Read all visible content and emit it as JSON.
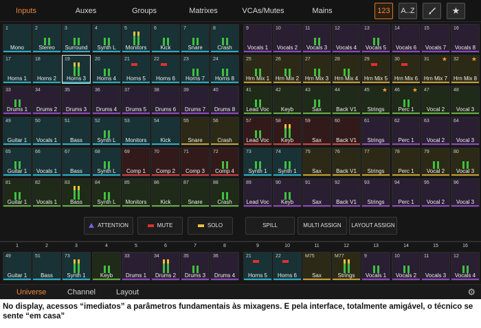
{
  "top_tabs": [
    "Inputs",
    "Auxes",
    "Groups",
    "Matrixes",
    "VCAs/Mutes",
    "Mains"
  ],
  "top_buttons": {
    "numeric": "123",
    "alpha": "A..Z"
  },
  "colors": {
    "accent": "#f0883a",
    "mute": "#e03030",
    "attention": "#7060e0",
    "solo": "#f0c040"
  },
  "grid_rows": [
    [
      {
        "n": "1",
        "name": "Mono",
        "c": "teal"
      },
      {
        "n": "2",
        "name": "Stereo",
        "c": "teal",
        "m": 1
      },
      {
        "n": "3",
        "name": "Surround",
        "c": "teal",
        "m": 1
      },
      {
        "n": "4",
        "name": "Synth L",
        "c": "teal",
        "m": 1
      },
      {
        "n": "5",
        "name": "Monitors",
        "c": "teal",
        "m": 2
      },
      {
        "n": "6",
        "name": "Kick",
        "c": "teal",
        "m": 1
      },
      {
        "n": "7",
        "name": "Snare",
        "c": "teal",
        "m": 1
      },
      {
        "n": "8",
        "name": "Crash",
        "c": "teal",
        "m": 1
      },
      {
        "n": "9",
        "name": "Vocals 1",
        "c": "purple"
      },
      {
        "n": "10",
        "name": "Vocals 2",
        "c": "purple"
      },
      {
        "n": "11",
        "name": "Vocals 3",
        "c": "purple",
        "m": 1
      },
      {
        "n": "12",
        "name": "Vocals 4",
        "c": "purple"
      },
      {
        "n": "13",
        "name": "Vocals 5",
        "c": "purple",
        "m": 1
      },
      {
        "n": "14",
        "name": "Vocals 6",
        "c": "purple"
      },
      {
        "n": "15",
        "name": "Vocals 7",
        "c": "purple"
      },
      {
        "n": "16",
        "name": "Vocals 8",
        "c": "purple"
      }
    ],
    [
      {
        "n": "17",
        "name": "Horns 1",
        "c": "teal"
      },
      {
        "n": "18",
        "name": "Horns 2",
        "c": "teal"
      },
      {
        "n": "19",
        "name": "Horns 3",
        "c": "teal",
        "m": 2,
        "sel": 1
      },
      {
        "n": "20",
        "name": "Horns 4",
        "c": "teal",
        "m": 1
      },
      {
        "n": "21",
        "name": "Horns 5",
        "c": "teal",
        "mute": 1
      },
      {
        "n": "22",
        "name": "Horns 6",
        "c": "teal",
        "mute": 1
      },
      {
        "n": "23",
        "name": "Horns 7",
        "c": "teal",
        "m": 1
      },
      {
        "n": "24",
        "name": "Horns 8",
        "c": "teal",
        "m": 1
      },
      {
        "n": "25",
        "name": "Hrn Mix 1",
        "c": "olive",
        "m": 1
      },
      {
        "n": "26",
        "name": "Hrn Mix 2",
        "c": "olive",
        "m": 1
      },
      {
        "n": "27",
        "name": "Hrn Mix 3",
        "c": "olive",
        "m": 1
      },
      {
        "n": "28",
        "name": "Hrn Mix 4",
        "c": "olive",
        "m": 1
      },
      {
        "n": "29",
        "name": "Hrn Mix 5",
        "c": "olive",
        "mute": 1
      },
      {
        "n": "30",
        "name": "Hrn Mix 6",
        "c": "olive",
        "mute": 1
      },
      {
        "n": "31",
        "name": "Hrn Mix 7",
        "c": "olive",
        "star": 1
      },
      {
        "n": "32",
        "name": "Hrn Mix 8",
        "c": "olive",
        "star": 1
      }
    ],
    [
      {
        "n": "33",
        "name": "Drums 1",
        "c": "purple",
        "m": 1
      },
      {
        "n": "34",
        "name": "Drums 2",
        "c": "purple"
      },
      {
        "n": "35",
        "name": "Drums 3",
        "c": "purple"
      },
      {
        "n": "36",
        "name": "Drums 4",
        "c": "purple"
      },
      {
        "n": "37",
        "name": "Drums 5",
        "c": "purple"
      },
      {
        "n": "38",
        "name": "Drums 6",
        "c": "purple"
      },
      {
        "n": "39",
        "name": "Drums 7",
        "c": "purple"
      },
      {
        "n": "40",
        "name": "Drums 8",
        "c": "purple"
      },
      {
        "n": "41",
        "name": "Lead Voc",
        "c": "green",
        "m": 1
      },
      {
        "n": "42",
        "name": "Keyb",
        "c": "green"
      },
      {
        "n": "43",
        "name": "Sax",
        "c": "green",
        "m": 1
      },
      {
        "n": "44",
        "name": "Back V1",
        "c": "green"
      },
      {
        "n": "45",
        "name": "Strings",
        "c": "green",
        "star": 1
      },
      {
        "n": "46",
        "name": "Perc 1",
        "c": "green",
        "m": 1,
        "star": 1
      },
      {
        "n": "47",
        "name": "Vocal 2",
        "c": "green"
      },
      {
        "n": "48",
        "name": "Vocal 3",
        "c": "green"
      }
    ],
    [
      {
        "n": "49",
        "name": "Guitar 1",
        "c": "teal"
      },
      {
        "n": "50",
        "name": "Vocals 1",
        "c": "teal"
      },
      {
        "n": "51",
        "name": "Bass",
        "c": "teal"
      },
      {
        "n": "52",
        "name": "Synth L",
        "c": "teal",
        "m": 1
      },
      {
        "n": "53",
        "name": "Monitors",
        "c": "teal"
      },
      {
        "n": "54",
        "name": "Kick",
        "c": "teal"
      },
      {
        "n": "55",
        "name": "Snare",
        "c": "olive"
      },
      {
        "n": "56",
        "name": "Crash",
        "c": "olive"
      },
      {
        "n": "57",
        "name": "Lead Voc",
        "c": "red",
        "m": 1
      },
      {
        "n": "58",
        "name": "Keyb",
        "c": "red",
        "m": 2
      },
      {
        "n": "59",
        "name": "Sax",
        "c": "red"
      },
      {
        "n": "60",
        "name": "Back V1",
        "c": "red"
      },
      {
        "n": "61",
        "name": "Strings",
        "c": "purple"
      },
      {
        "n": "62",
        "name": "Perc 1",
        "c": "purple"
      },
      {
        "n": "63",
        "name": "Vocal 2",
        "c": "purple"
      },
      {
        "n": "64",
        "name": "Vocal 3",
        "c": "purple"
      }
    ],
    [
      {
        "n": "65",
        "name": "Guitar 1",
        "c": "teal",
        "m": 1
      },
      {
        "n": "66",
        "name": "Vocals 1",
        "c": "teal"
      },
      {
        "n": "67",
        "name": "Bass",
        "c": "teal"
      },
      {
        "n": "68",
        "name": "Synth L",
        "c": "teal",
        "m": 1
      },
      {
        "n": "69",
        "name": "Comp 1",
        "c": "red"
      },
      {
        "n": "70",
        "name": "Comp 2",
        "c": "red"
      },
      {
        "n": "71",
        "name": "Comp 3",
        "c": "red"
      },
      {
        "n": "72",
        "name": "Comp 4",
        "c": "red",
        "m": 1
      },
      {
        "n": "73",
        "name": "Synth 1",
        "c": "teal",
        "m": 1
      },
      {
        "n": "74",
        "name": "Synth 1",
        "c": "teal",
        "m": 1
      },
      {
        "n": "75",
        "name": "Sax",
        "c": "olive"
      },
      {
        "n": "76",
        "name": "Back V1",
        "c": "olive"
      },
      {
        "n": "77",
        "name": "Strings",
        "c": "olive"
      },
      {
        "n": "78",
        "name": "Perc 1",
        "c": "olive"
      },
      {
        "n": "79",
        "name": "Vocal 2",
        "c": "olive",
        "m": 1
      },
      {
        "n": "80",
        "name": "Vocal 3",
        "c": "olive",
        "m": 1
      }
    ],
    [
      {
        "n": "81",
        "name": "Guitar 1",
        "c": "green",
        "m": 1
      },
      {
        "n": "82",
        "name": "Vocals 1",
        "c": "green"
      },
      {
        "n": "83",
        "name": "Bass",
        "c": "green",
        "m": 2
      },
      {
        "n": "84",
        "name": "Synth L",
        "c": "green",
        "m": 1
      },
      {
        "n": "85",
        "name": "Monitors",
        "c": "green"
      },
      {
        "n": "86",
        "name": "Kick",
        "c": "green"
      },
      {
        "n": "87",
        "name": "Snare",
        "c": "green"
      },
      {
        "n": "88",
        "name": "Crash",
        "c": "green",
        "m": 1
      },
      {
        "n": "89",
        "name": "Lead Voc",
        "c": "purple"
      },
      {
        "n": "90",
        "name": "Keyb",
        "c": "purple",
        "m": 1
      },
      {
        "n": "91",
        "name": "Sax",
        "c": "purple"
      },
      {
        "n": "92",
        "name": "Back V1",
        "c": "purple"
      },
      {
        "n": "93",
        "name": "Strings",
        "c": "purple"
      },
      {
        "n": "94",
        "name": "Perc 1",
        "c": "purple"
      },
      {
        "n": "95",
        "name": "Vocal 2",
        "c": "purple"
      },
      {
        "n": "96",
        "name": "Vocal 3",
        "c": "purple"
      }
    ]
  ],
  "action_buttons": {
    "attention": "ATTENTION",
    "mute": "MUTE",
    "solo": "SOLO",
    "spill": "SPILL",
    "multi_assign": "MULTI ASSIGN",
    "layout_assign": "LAYOUT ASSIGN"
  },
  "bottom_strips": [
    {
      "h": "1",
      "n": "49",
      "name": "Guitar 1",
      "c": "teal"
    },
    {
      "h": "2",
      "n": "51",
      "name": "Bass",
      "c": "teal"
    },
    {
      "h": "3",
      "n": "73",
      "name": "Synth 1",
      "c": "teal",
      "m": 2
    },
    {
      "h": "4",
      "n": "",
      "name": "Keyb",
      "c": "green",
      "m": 1
    },
    {
      "h": "5",
      "n": "33",
      "name": "Drums 1",
      "c": "purple"
    },
    {
      "h": "6",
      "n": "34",
      "name": "Drums 2",
      "c": "purple",
      "m": 2
    },
    {
      "h": "7",
      "n": "35",
      "name": "Drums 3",
      "c": "purple",
      "m": 1
    },
    {
      "h": "8",
      "n": "36",
      "name": "Drums 4",
      "c": "purple"
    },
    {
      "h": "9",
      "n": "21",
      "name": "Horns 5",
      "c": "teal",
      "mute": 1
    },
    {
      "h": "10",
      "n": "22",
      "name": "Horns 6",
      "c": "teal",
      "mute": 1
    },
    {
      "h": "11",
      "n": "M75",
      "name": "Sax",
      "c": "olive"
    },
    {
      "h": "12",
      "n": "M77",
      "name": "Strings",
      "c": "olive",
      "m": 2
    },
    {
      "h": "13",
      "n": "9",
      "name": "Vocals 1",
      "c": "purple",
      "m": 1
    },
    {
      "h": "14",
      "n": "10",
      "name": "Vocals 2",
      "c": "purple",
      "m": 1
    },
    {
      "h": "15",
      "n": "11",
      "name": "Vocals 3",
      "c": "purple"
    },
    {
      "h": "16",
      "n": "12",
      "name": "Vocals 4",
      "c": "purple",
      "m": 1
    }
  ],
  "bottom_tabs": [
    "Universe",
    "Channel",
    "Layout"
  ],
  "caption": "No display, acessos “imediatos” a parâmetros fundamentais às mixagens. E pela interface, totalmente amigável, o técnico se sente “em casa”"
}
